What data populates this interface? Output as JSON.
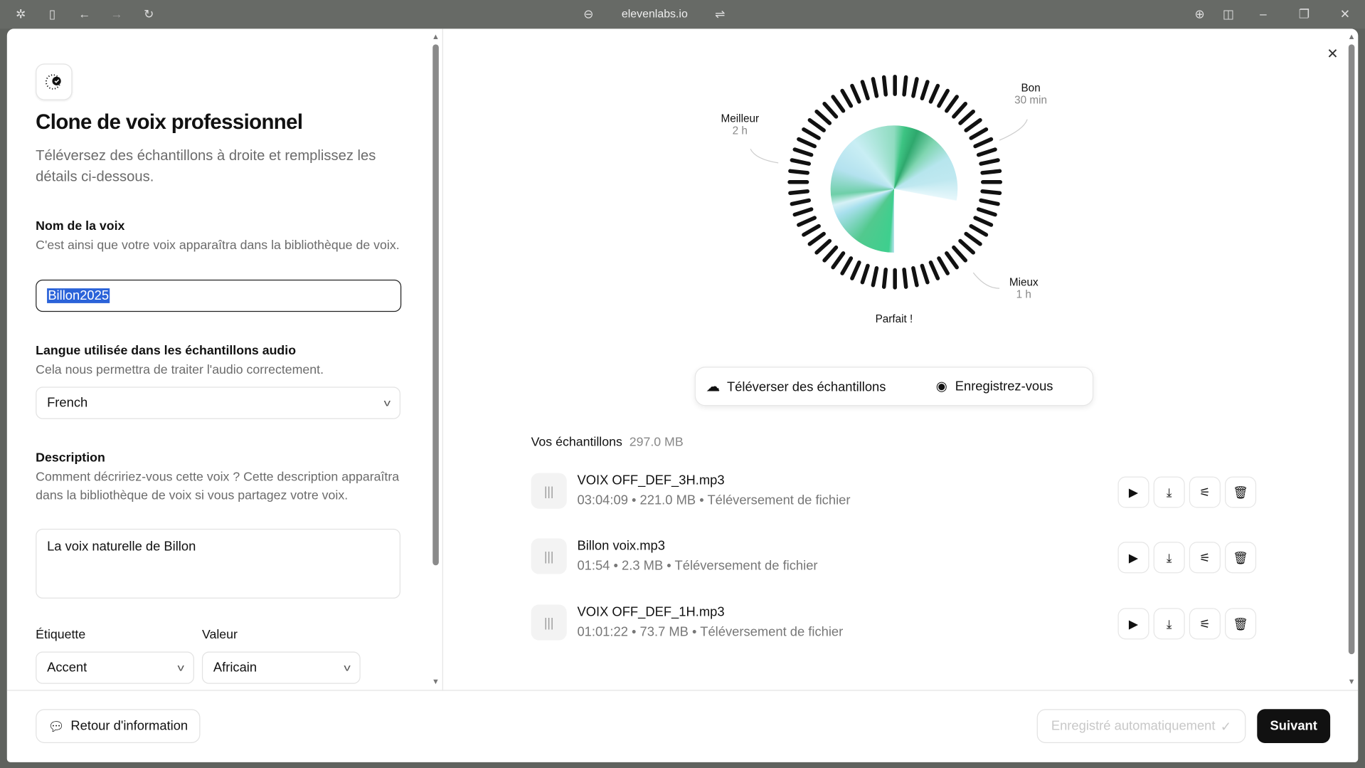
{
  "browser": {
    "url": "elevenlabs.io"
  },
  "left": {
    "title": "Clone de voix professionnel",
    "subtitle": "Téléversez des échantillons à droite et remplissez les détails ci-dessous.",
    "voice_name": {
      "label": "Nom de la voix",
      "help": "C'est ainsi que votre voix apparaîtra dans la bibliothèque de voix.",
      "value": "Billon2025"
    },
    "language": {
      "label": "Langue utilisée dans les échantillons audio",
      "help": "Cela nous permettra de traiter l'audio correctement.",
      "value": "French"
    },
    "description": {
      "label": "Description",
      "help": "Comment décririez-vous cette voix ? Cette description apparaîtra dans la bibliothèque de voix si vous partagez votre voix.",
      "value": "La voix naturelle de Billon"
    },
    "tag": {
      "label": "Étiquette",
      "value": "Accent"
    },
    "tag_value": {
      "label": "Valeur",
      "value": "Africain"
    }
  },
  "gauge": {
    "levels": [
      {
        "title": "Bon",
        "value": "30 min"
      },
      {
        "title": "Mieux",
        "value": "1 h"
      },
      {
        "title": "Meilleur",
        "value": "2 h"
      }
    ],
    "status": "Parfait !",
    "accent_color": "#3ecf8e"
  },
  "actions": {
    "upload": "Téléverser des échantillons",
    "record": "Enregistrez-vous"
  },
  "samples": {
    "title": "Vos échantillons",
    "total": "297.0 MB",
    "items": [
      {
        "name": "VOIX OFF_DEF_3H.mp3",
        "duration": "03:04:09",
        "size": "221.0 MB",
        "source": "Téléversement de fichier"
      },
      {
        "name": "Billon voix.mp3",
        "duration": "01:54",
        "size": "2.3 MB",
        "source": "Téléversement de fichier"
      },
      {
        "name": "VOIX OFF_DEF_1H.mp3",
        "duration": "01:01:22",
        "size": "73.7 MB",
        "source": "Téléversement de fichier"
      }
    ]
  },
  "footer": {
    "feedback": "Retour d'information",
    "autosaved": "Enregistré automatiquement",
    "next": "Suivant"
  }
}
